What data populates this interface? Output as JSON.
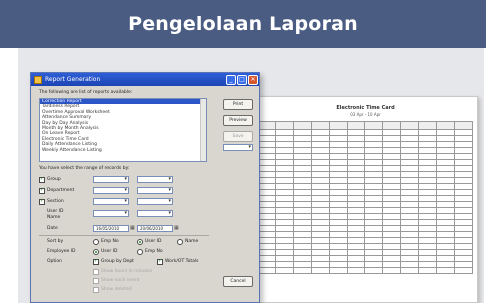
{
  "header": {
    "title": "Pengelolaan Laporan"
  },
  "dialog": {
    "title": "Report Generation",
    "intro": "The following are list of reports available:",
    "reports": [
      "Correction Report",
      "Tardiness Report",
      "Overtime Approval Worksheet",
      "Attendance Summary",
      "Day by Day Analysis",
      "Month by Month Analysis",
      "On Leave Report",
      "Electronic Time Card",
      "Daily Attendance Listing",
      "Weekly Attendance Listing"
    ],
    "range_text": "You have select the range of records by:",
    "filters": {
      "group": "Group",
      "department": "Department",
      "section": "Section",
      "user_id": "User ID",
      "name": "Name"
    },
    "date_label": "Date",
    "date_from": "16/05/2010",
    "date_to": "20/06/2010",
    "sort_label": "Sort by",
    "sort_options": [
      "Emp No",
      "User ID",
      "Name"
    ],
    "employee_id_label": "Employee ID",
    "employee_id_options": [
      "User ID",
      "Emp No"
    ],
    "option_label": "Option",
    "option_checks": {
      "group_by_dept": "Group by Dept",
      "work_ot_totals": "Work/OT Totals"
    },
    "disabled_options": [
      "Show hours in minutes",
      "Show each event",
      "Show deleted"
    ],
    "buttons": {
      "print": "Print",
      "preview": "Preview",
      "save": "Save",
      "cancel": "Cancel"
    },
    "window_controls": {
      "minimize": "_",
      "maximize": "□",
      "close": "✕"
    }
  },
  "report_preview": {
    "title": "Electronic Time Card",
    "subtitle": "03 Apr - 10 Apr"
  },
  "colors": {
    "header_bg": "#4b5c82",
    "titlebar": "#2f5fd6",
    "selection": "#2d56c8"
  }
}
